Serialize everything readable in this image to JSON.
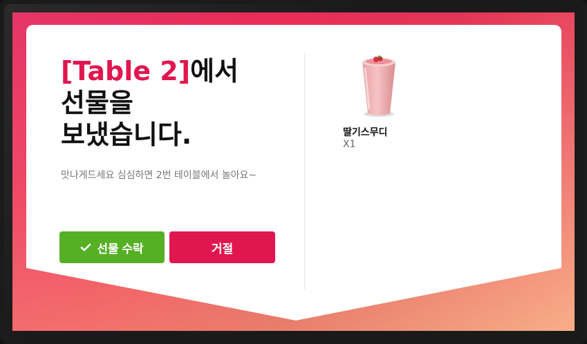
{
  "gift_dialog": {
    "table_name": "[Table 2]",
    "title_suffix_line1": "에서",
    "title_line2": "선물을",
    "title_line3": "보냈습니다.",
    "message": "맛나게드세요 심심하면 2번 테이블에서 놀아요~",
    "accept_label": "선물 수락",
    "reject_label": "거절"
  },
  "gift_item": {
    "name": "딸기스무디",
    "quantity": "X1",
    "icon": "strawberry-smoothie-image"
  },
  "colors": {
    "accent": "#e0174f",
    "accept": "#55b024"
  }
}
